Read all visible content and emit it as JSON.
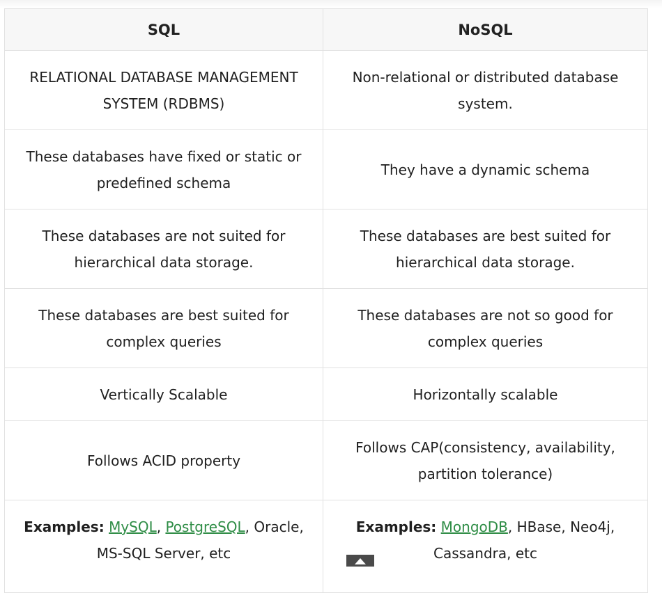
{
  "table": {
    "headers": [
      "SQL",
      "NoSQL"
    ],
    "rows": [
      [
        "RELATIONAL DATABASE MANAGEMENT SYSTEM (RDBMS)",
        "Non-relational or distributed database system."
      ],
      [
        "These databases have fixed or static or predefined schema",
        "They have a dynamic schema"
      ],
      [
        "These databases are not suited for hierarchical data storage.",
        "These databases are best suited for hierarchical data storage."
      ],
      [
        "These databases are best suited for complex queries",
        "These databases are not so good for complex queries"
      ],
      [
        "Vertically Scalable",
        "Horizontally scalable"
      ],
      [
        "Follows ACID property",
        "Follows CAP(consistency, availability, partition tolerance)"
      ]
    ],
    "examples": {
      "label": "Examples:",
      "sql": {
        "link1": "MySQL",
        "sep1": ", ",
        "link2": "PostgreSQL",
        "rest": ", Oracle, MS-SQL Server, etc"
      },
      "nosql": {
        "link1": "MongoDB",
        "rest": ", HBase, Neo4j, Cassandra, etc"
      }
    }
  },
  "colors": {
    "link": "#2f8d46",
    "border": "#e2e2e2",
    "header_bg": "#f7f7f7",
    "scroll_button": "#4a4a4a"
  },
  "icons": [
    "arrow-up-icon"
  ]
}
